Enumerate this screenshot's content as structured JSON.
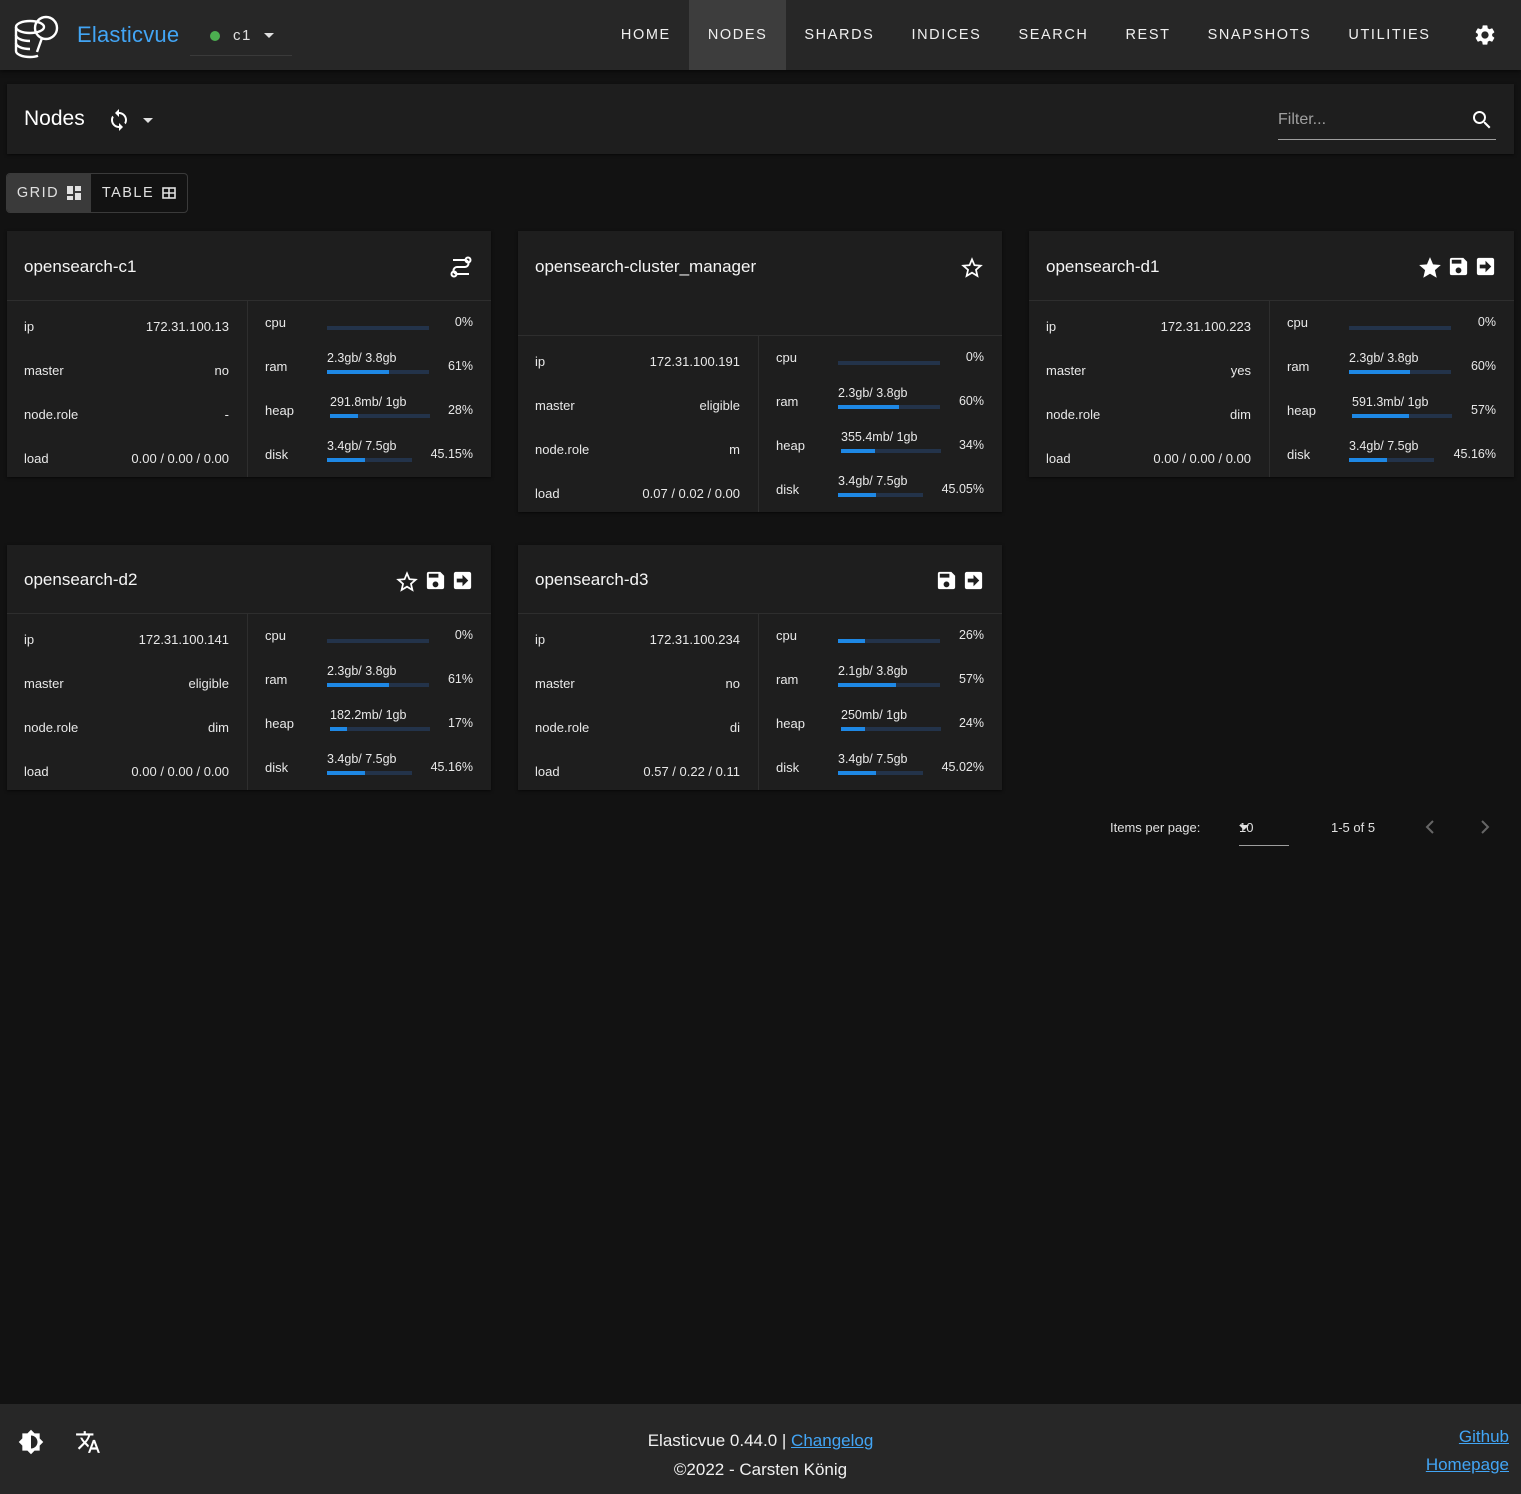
{
  "app": {
    "brand": "Elasticvue"
  },
  "cluster": {
    "name": "c1",
    "status_color": "#4caf50"
  },
  "nav": {
    "items": [
      {
        "label": "HOME",
        "active": false
      },
      {
        "label": "NODES",
        "active": true
      },
      {
        "label": "SHARDS",
        "active": false
      },
      {
        "label": "INDICES",
        "active": false
      },
      {
        "label": "SEARCH",
        "active": false
      },
      {
        "label": "REST",
        "active": false
      },
      {
        "label": "SNAPSHOTS",
        "active": false
      },
      {
        "label": "UTILITIES",
        "active": false
      }
    ],
    "settings_icon": "gear-icon"
  },
  "header": {
    "title": "Nodes",
    "filter_placeholder": "Filter..."
  },
  "view_toggle": {
    "grid_label": "GRID",
    "table_label": "TABLE",
    "active": "grid"
  },
  "accent_color": "#1e88e5",
  "nodes": [
    {
      "name": "opensearch-c1",
      "icons": [
        "cluster-manager-icon"
      ],
      "ip": "172.31.100.13",
      "master": "no",
      "node_role": "-",
      "load": "0.00 / 0.00 / 0.00",
      "cpu": {
        "text": "",
        "pct": "0%",
        "value": 0
      },
      "ram": {
        "text": "2.3gb/ 3.8gb",
        "pct": "61%",
        "value": 61
      },
      "heap": {
        "text": "291.8mb/ 1gb",
        "pct": "28%",
        "value": 28
      },
      "disk": {
        "text": "3.4gb/ 7.5gb",
        "pct": "45.15%",
        "value": 45.15
      }
    },
    {
      "name": "opensearch-cluster_manager",
      "icons": [
        "star-outline-icon"
      ],
      "ip": "172.31.100.191",
      "master": "eligible",
      "node_role": "m",
      "load": "0.07 / 0.02 / 0.00",
      "cpu": {
        "text": "",
        "pct": "0%",
        "value": 0
      },
      "ram": {
        "text": "2.3gb/ 3.8gb",
        "pct": "60%",
        "value": 60
      },
      "heap": {
        "text": "355.4mb/ 1gb",
        "pct": "34%",
        "value": 34
      },
      "disk": {
        "text": "3.4gb/ 7.5gb",
        "pct": "45.05%",
        "value": 45.05
      }
    },
    {
      "name": "opensearch-d1",
      "icons": [
        "star-filled-icon",
        "save-icon",
        "arrow-right-box-icon"
      ],
      "ip": "172.31.100.223",
      "master": "yes",
      "node_role": "dim",
      "load": "0.00 / 0.00 / 0.00",
      "cpu": {
        "text": "",
        "pct": "0%",
        "value": 0
      },
      "ram": {
        "text": "2.3gb/ 3.8gb",
        "pct": "60%",
        "value": 60
      },
      "heap": {
        "text": "591.3mb/ 1gb",
        "pct": "57%",
        "value": 57
      },
      "disk": {
        "text": "3.4gb/ 7.5gb",
        "pct": "45.16%",
        "value": 45.16
      }
    },
    {
      "name": "opensearch-d2",
      "icons": [
        "star-outline-icon",
        "save-icon",
        "arrow-right-box-icon"
      ],
      "ip": "172.31.100.141",
      "master": "eligible",
      "node_role": "dim",
      "load": "0.00 / 0.00 / 0.00",
      "cpu": {
        "text": "",
        "pct": "0%",
        "value": 0
      },
      "ram": {
        "text": "2.3gb/ 3.8gb",
        "pct": "61%",
        "value": 61
      },
      "heap": {
        "text": "182.2mb/ 1gb",
        "pct": "17%",
        "value": 17
      },
      "disk": {
        "text": "3.4gb/ 7.5gb",
        "pct": "45.16%",
        "value": 45.16
      }
    },
    {
      "name": "opensearch-d3",
      "icons": [
        "save-icon",
        "arrow-right-box-icon"
      ],
      "ip": "172.31.100.234",
      "master": "no",
      "node_role": "di",
      "load": "0.57 / 0.22 / 0.11",
      "cpu": {
        "text": "",
        "pct": "26%",
        "value": 26
      },
      "ram": {
        "text": "2.1gb/ 3.8gb",
        "pct": "57%",
        "value": 57
      },
      "heap": {
        "text": "250mb/ 1gb",
        "pct": "24%",
        "value": 24
      },
      "disk": {
        "text": "3.4gb/ 7.5gb",
        "pct": "45.02%",
        "value": 45.02
      }
    }
  ],
  "labels": {
    "ip": "ip",
    "master": "master",
    "node_role": "node.role",
    "load": "load",
    "cpu": "cpu",
    "ram": "ram",
    "heap": "heap",
    "disk": "disk"
  },
  "pagination": {
    "items_per_page_label": "Items per page:",
    "items_per_page": "10",
    "range": "1-5 of 5"
  },
  "footer": {
    "version_text": "Elasticvue 0.44.0 |",
    "changelog_label": "Changelog",
    "copyright": "©2022 - Carsten König",
    "github_label": "Github",
    "homepage_label": "Homepage"
  }
}
